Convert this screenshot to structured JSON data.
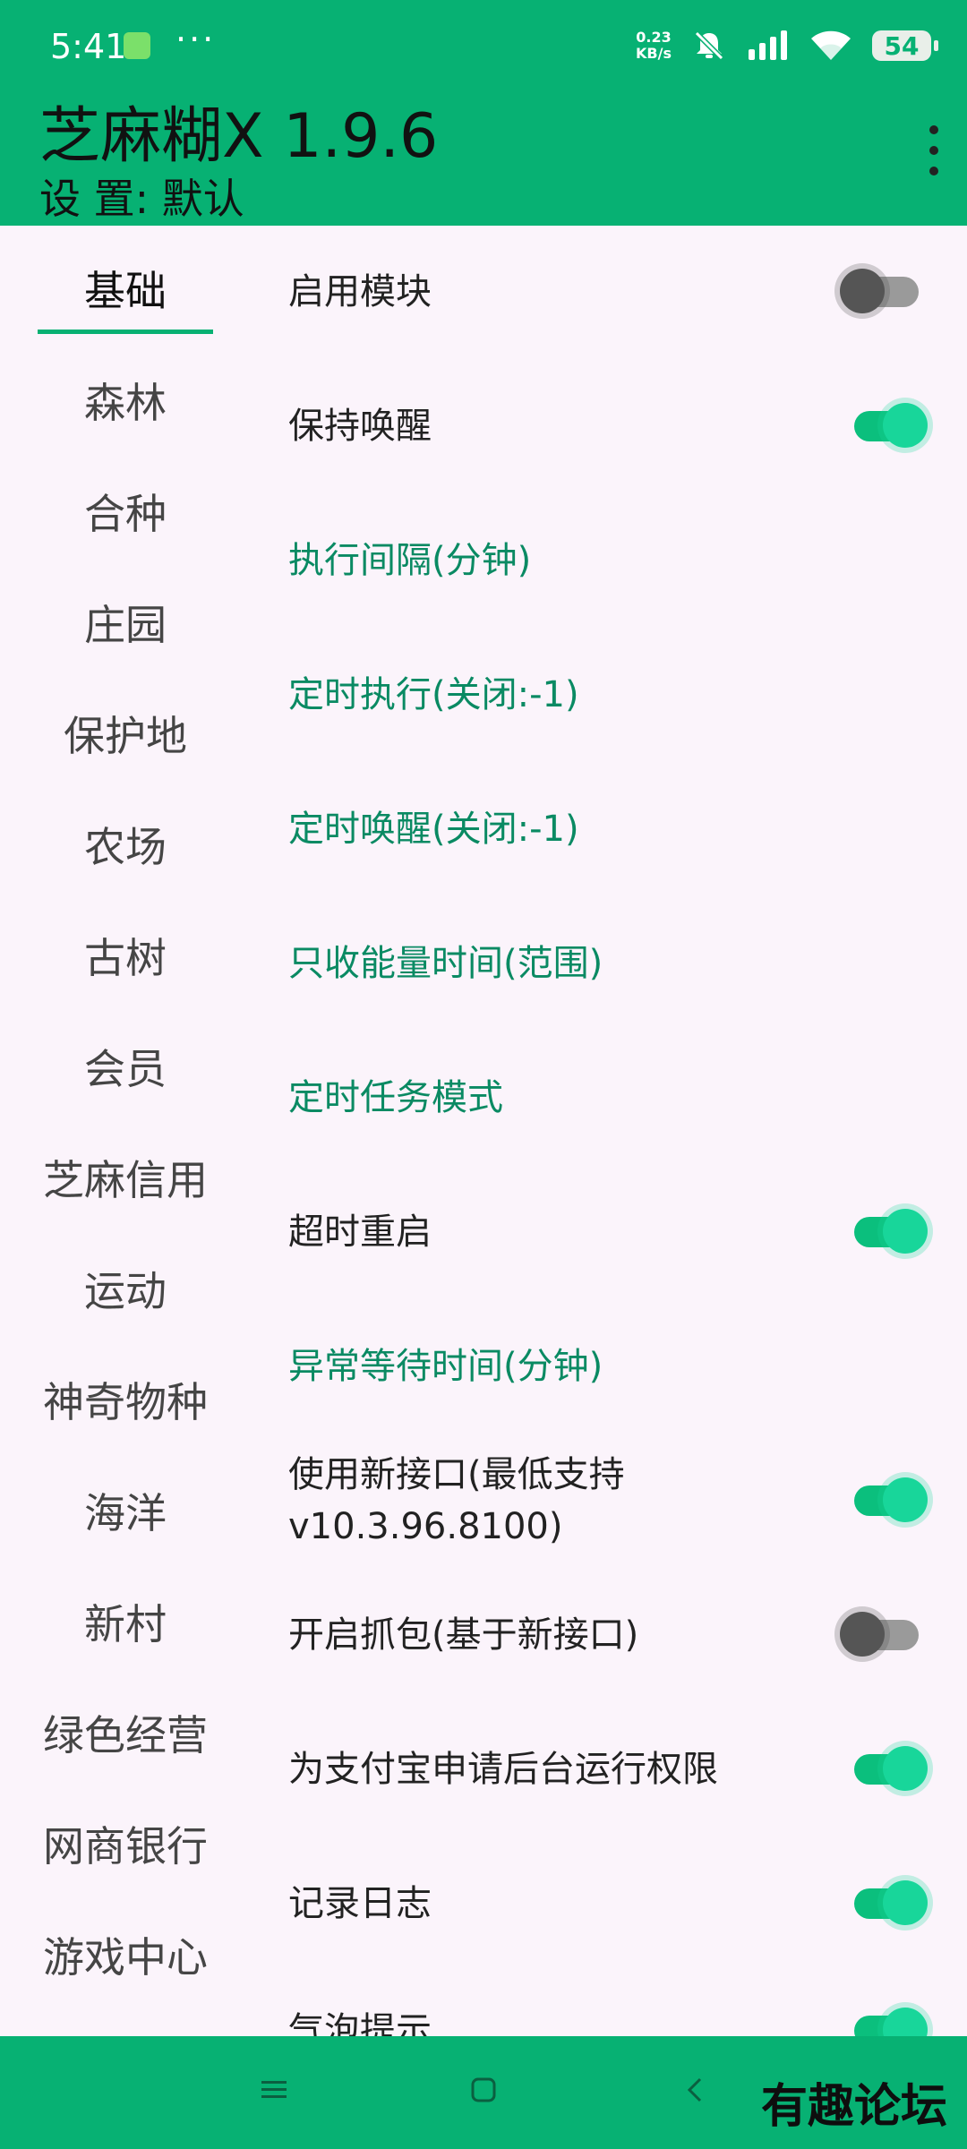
{
  "status_bar": {
    "time": "5:41",
    "dots": "···",
    "net_speed_value": "0.23",
    "net_speed_unit": "KB/s",
    "battery": "54"
  },
  "app_bar": {
    "title": "芝麻糊X 1.9.6",
    "subtitle": "设 置: 默认"
  },
  "sidenav": {
    "items": [
      {
        "label": "基础",
        "active": true
      },
      {
        "label": "森林"
      },
      {
        "label": "合种"
      },
      {
        "label": "庄园"
      },
      {
        "label": "保护地"
      },
      {
        "label": "农场"
      },
      {
        "label": "古树"
      },
      {
        "label": "会员"
      },
      {
        "label": "芝麻信用"
      },
      {
        "label": "运动"
      },
      {
        "label": "神奇物种"
      },
      {
        "label": "海洋"
      },
      {
        "label": "新村"
      },
      {
        "label": "绿色经营"
      },
      {
        "label": "网商银行"
      },
      {
        "label": "游戏中心"
      }
    ]
  },
  "settings": [
    {
      "label": "启用模块",
      "type": "toggle",
      "enabled": false
    },
    {
      "label": "保持唤醒",
      "type": "toggle",
      "enabled": true
    },
    {
      "label": "执行间隔(分钟)",
      "type": "section"
    },
    {
      "label": "定时执行(关闭:-1)",
      "type": "section"
    },
    {
      "label": "定时唤醒(关闭:-1)",
      "type": "section"
    },
    {
      "label": "只收能量时间(范围)",
      "type": "section"
    },
    {
      "label": "定时任务模式",
      "type": "section"
    },
    {
      "label": "超时重启",
      "type": "toggle",
      "enabled": true
    },
    {
      "label": "异常等待时间(分钟)",
      "type": "section"
    },
    {
      "label": "使用新接口(最低支持",
      "label_line2": "v10.3.96.8100)",
      "type": "toggle",
      "enabled": true
    },
    {
      "label": "开启抓包(基于新接口)",
      "type": "toggle",
      "enabled": false
    },
    {
      "label": "为支付宝申请后台运行权限",
      "type": "toggle",
      "enabled": true
    },
    {
      "label": "记录日志",
      "type": "toggle",
      "enabled": true
    },
    {
      "label": "气泡提示",
      "type": "toggle",
      "enabled": true
    }
  ],
  "watermark": "有趣论坛",
  "colors": {
    "primary": "#07b173",
    "section_text": "#0a8a63",
    "background": "#fbf4fb"
  }
}
